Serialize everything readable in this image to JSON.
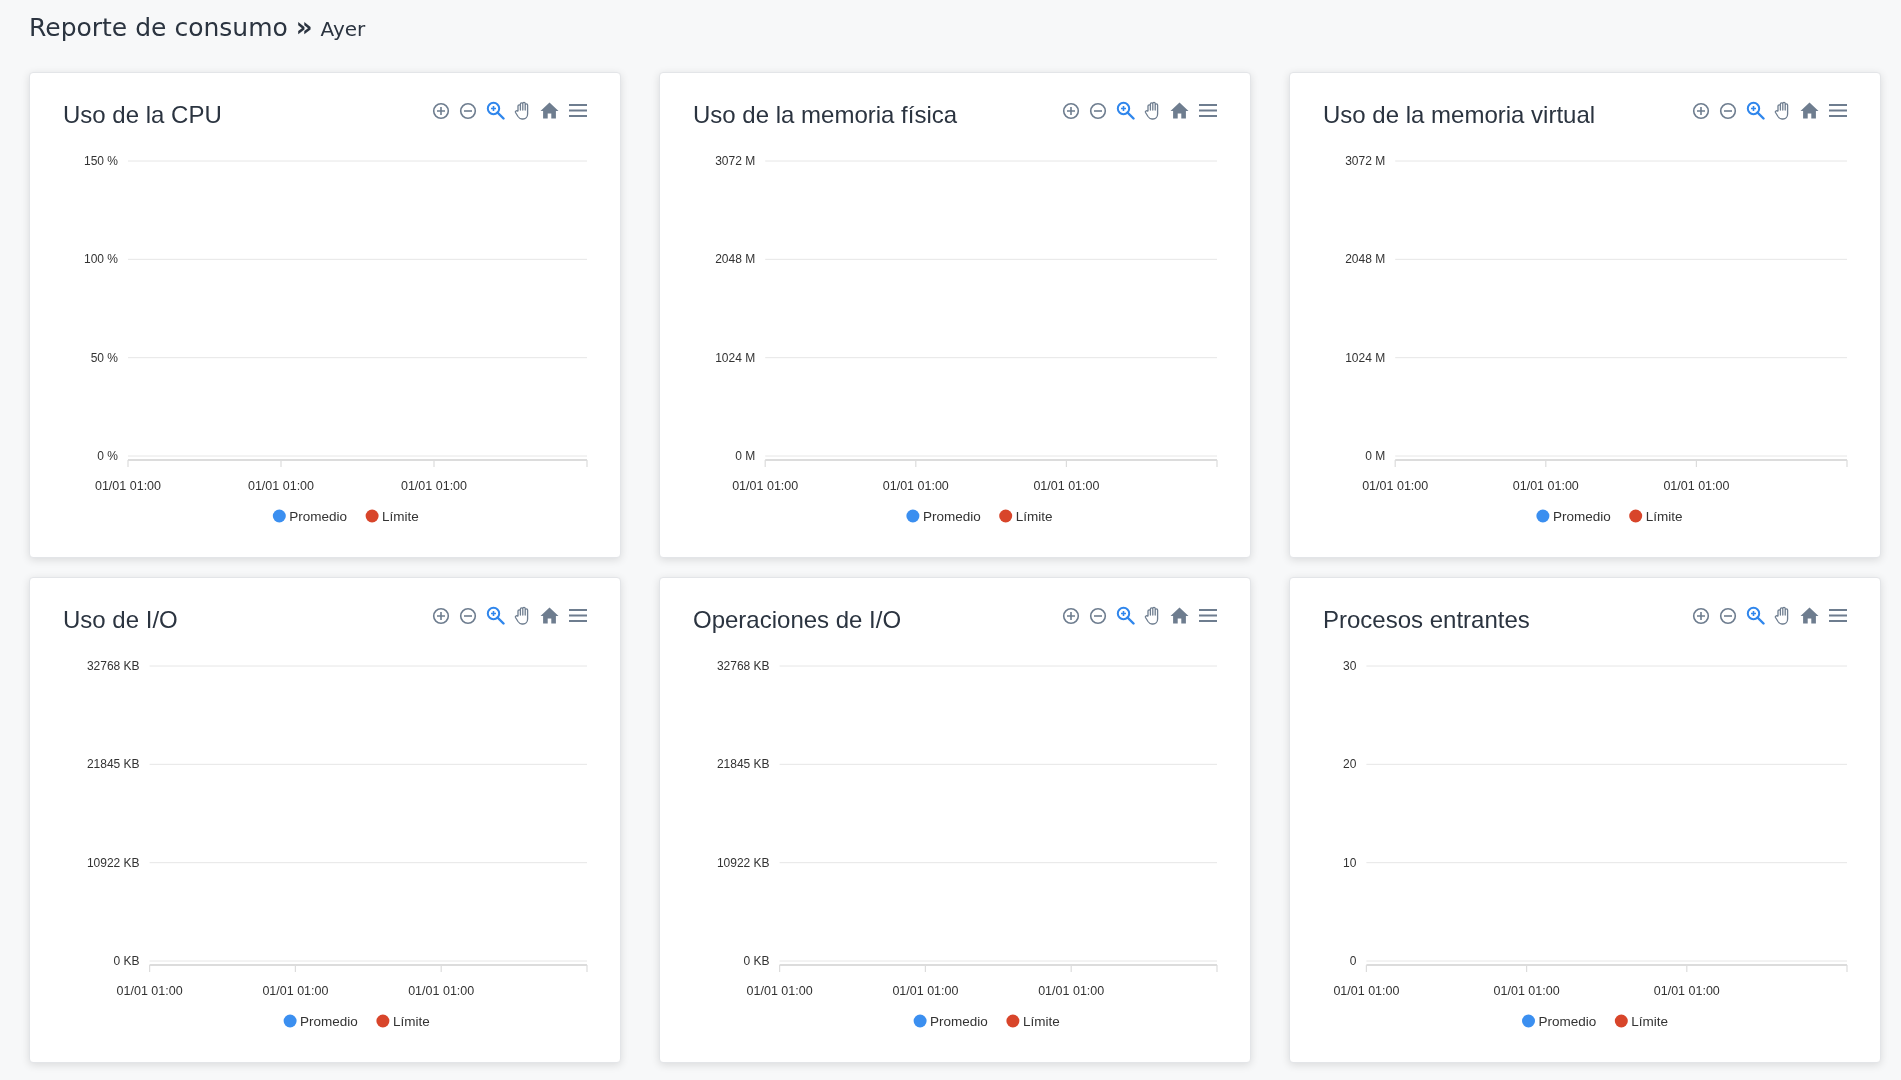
{
  "header": {
    "title": "Reporte de consumo",
    "separator": "»",
    "subtitle": "Ayer"
  },
  "cards": [
    {
      "title": "Uso de la CPU",
      "tools": [
        {
          "kind": "zoom-in",
          "selected": false
        },
        {
          "kind": "zoom-out",
          "selected": false
        },
        {
          "kind": "zoom",
          "selected": true
        },
        {
          "kind": "pan",
          "selected": false
        },
        {
          "kind": "home",
          "selected": false
        },
        {
          "kind": "menu",
          "selected": false
        }
      ],
      "chart_data": {
        "type": "line",
        "ylim": [
          0,
          150
        ],
        "yticks": [
          {
            "value": 0,
            "label": "0 %"
          },
          {
            "value": 50,
            "label": "50 %"
          },
          {
            "value": 100,
            "label": "100 %"
          },
          {
            "value": 150,
            "label": "150 %"
          }
        ],
        "categories": [
          "01/01 01:00",
          "01/01 01:00",
          "01/01 01:00"
        ],
        "series": [
          {
            "name": "Promedio",
            "color": "#3b8ff0",
            "values": [
              null,
              null,
              null
            ]
          },
          {
            "name": "Límite",
            "color": "#d8452a",
            "values": [
              null,
              null,
              null
            ]
          }
        ]
      }
    },
    {
      "title": "Uso de la memoria física",
      "tools": [
        {
          "kind": "zoom-in",
          "selected": false
        },
        {
          "kind": "zoom-out",
          "selected": false
        },
        {
          "kind": "zoom",
          "selected": true
        },
        {
          "kind": "pan",
          "selected": false
        },
        {
          "kind": "home",
          "selected": false
        },
        {
          "kind": "menu",
          "selected": false
        }
      ],
      "chart_data": {
        "type": "line",
        "ylim": [
          0,
          3072
        ],
        "yticks": [
          {
            "value": 0,
            "label": "0 M"
          },
          {
            "value": 1024,
            "label": "1024 M"
          },
          {
            "value": 2048,
            "label": "2048 M"
          },
          {
            "value": 3072,
            "label": "3072 M"
          }
        ],
        "categories": [
          "01/01 01:00",
          "01/01 01:00",
          "01/01 01:00"
        ],
        "series": [
          {
            "name": "Promedio",
            "color": "#3b8ff0",
            "values": [
              null,
              null,
              null
            ]
          },
          {
            "name": "Límite",
            "color": "#d8452a",
            "values": [
              null,
              null,
              null
            ]
          }
        ]
      }
    },
    {
      "title": "Uso de la memoria virtual",
      "tools": [
        {
          "kind": "zoom-in",
          "selected": false
        },
        {
          "kind": "zoom-out",
          "selected": false
        },
        {
          "kind": "zoom",
          "selected": true
        },
        {
          "kind": "pan",
          "selected": false
        },
        {
          "kind": "home",
          "selected": false
        },
        {
          "kind": "menu",
          "selected": false
        }
      ],
      "chart_data": {
        "type": "line",
        "ylim": [
          0,
          3072
        ],
        "yticks": [
          {
            "value": 0,
            "label": "0 M"
          },
          {
            "value": 1024,
            "label": "1024 M"
          },
          {
            "value": 2048,
            "label": "2048 M"
          },
          {
            "value": 3072,
            "label": "3072 M"
          }
        ],
        "categories": [
          "01/01 01:00",
          "01/01 01:00",
          "01/01 01:00"
        ],
        "series": [
          {
            "name": "Promedio",
            "color": "#3b8ff0",
            "values": [
              null,
              null,
              null
            ]
          },
          {
            "name": "Límite",
            "color": "#d8452a",
            "values": [
              null,
              null,
              null
            ]
          }
        ]
      }
    },
    {
      "title": "Uso de I/O",
      "tools": [
        {
          "kind": "zoom-in",
          "selected": false
        },
        {
          "kind": "zoom-out",
          "selected": false
        },
        {
          "kind": "zoom",
          "selected": true
        },
        {
          "kind": "pan",
          "selected": false
        },
        {
          "kind": "home",
          "selected": false
        },
        {
          "kind": "menu",
          "selected": false
        }
      ],
      "chart_data": {
        "type": "line",
        "ylim": [
          0,
          32768
        ],
        "yticks": [
          {
            "value": 0,
            "label": "0 KB"
          },
          {
            "value": 10922,
            "label": "10922 KB"
          },
          {
            "value": 21845,
            "label": "21845 KB"
          },
          {
            "value": 32768,
            "label": "32768 KB"
          }
        ],
        "categories": [
          "01/01 01:00",
          "01/01 01:00",
          "01/01 01:00"
        ],
        "series": [
          {
            "name": "Promedio",
            "color": "#3b8ff0",
            "values": [
              null,
              null,
              null
            ]
          },
          {
            "name": "Límite",
            "color": "#d8452a",
            "values": [
              null,
              null,
              null
            ]
          }
        ]
      }
    },
    {
      "title": "Operaciones de I/O",
      "tools": [
        {
          "kind": "zoom-in",
          "selected": false
        },
        {
          "kind": "zoom-out",
          "selected": false
        },
        {
          "kind": "zoom",
          "selected": true
        },
        {
          "kind": "pan",
          "selected": false
        },
        {
          "kind": "home",
          "selected": false
        },
        {
          "kind": "menu",
          "selected": false
        }
      ],
      "chart_data": {
        "type": "line",
        "ylim": [
          0,
          32768
        ],
        "yticks": [
          {
            "value": 0,
            "label": "0 KB"
          },
          {
            "value": 10922,
            "label": "10922 KB"
          },
          {
            "value": 21845,
            "label": "21845 KB"
          },
          {
            "value": 32768,
            "label": "32768 KB"
          }
        ],
        "categories": [
          "01/01 01:00",
          "01/01 01:00",
          "01/01 01:00"
        ],
        "series": [
          {
            "name": "Promedio",
            "color": "#3b8ff0",
            "values": [
              null,
              null,
              null
            ]
          },
          {
            "name": "Límite",
            "color": "#d8452a",
            "values": [
              null,
              null,
              null
            ]
          }
        ]
      }
    },
    {
      "title": "Procesos entrantes",
      "tools": [
        {
          "kind": "zoom-in",
          "selected": false
        },
        {
          "kind": "zoom-out",
          "selected": false
        },
        {
          "kind": "zoom",
          "selected": true
        },
        {
          "kind": "pan",
          "selected": false
        },
        {
          "kind": "home",
          "selected": false
        },
        {
          "kind": "menu",
          "selected": false
        }
      ],
      "chart_data": {
        "type": "line",
        "ylim": [
          0,
          30
        ],
        "yticks": [
          {
            "value": 0,
            "label": "0"
          },
          {
            "value": 10,
            "label": "10"
          },
          {
            "value": 20,
            "label": "20"
          },
          {
            "value": 30,
            "label": "30"
          }
        ],
        "categories": [
          "01/01 01:00",
          "01/01 01:00",
          "01/01 01:00"
        ],
        "series": [
          {
            "name": "Promedio",
            "color": "#3b8ff0",
            "values": [
              null,
              null,
              null
            ]
          },
          {
            "name": "Límite",
            "color": "#d8452a",
            "values": [
              null,
              null,
              null
            ]
          }
        ]
      }
    }
  ]
}
